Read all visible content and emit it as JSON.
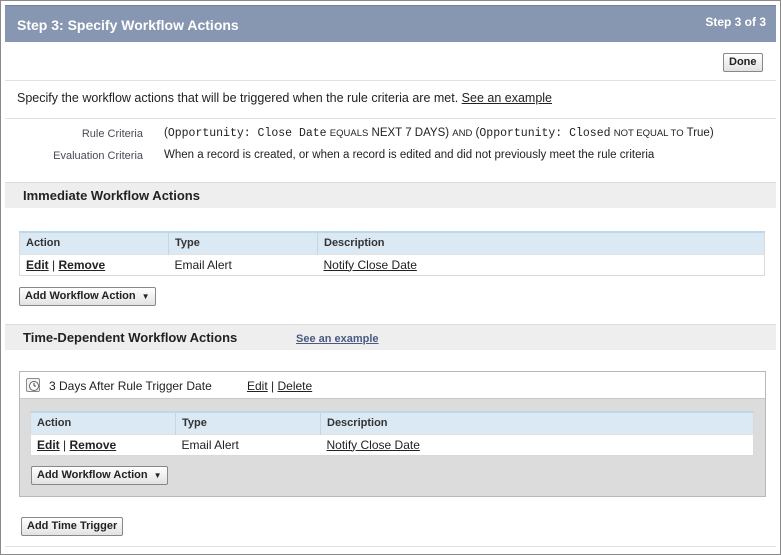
{
  "header": {
    "title": "Step 3: Specify Workflow Actions",
    "step": "Step 3 of 3"
  },
  "toolbar": {
    "done_label": "Done"
  },
  "intro": {
    "text": "Specify the workflow actions that will be triggered when the rule criteria are met.",
    "example_link": "See an example"
  },
  "criteria": {
    "rule_label": "Rule Criteria",
    "rule": {
      "open1": "(",
      "field1": "Opportunity: Close Date",
      "op1": "EQUALS",
      "val1": "NEXT 7 DAYS)",
      "and": "AND",
      "open2": "(",
      "field2": "Opportunity: Closed",
      "op2": "NOT EQUAL TO",
      "val2": "True)"
    },
    "eval_label": "Evaluation Criteria",
    "eval_value": "When a record is created, or when a record is edited and did not previously meet the rule criteria"
  },
  "immediate": {
    "title": "Immediate Workflow Actions",
    "columns": [
      "Action",
      "Type",
      "Description"
    ],
    "rows": [
      {
        "edit": "Edit",
        "sep": "|",
        "remove": "Remove",
        "type": "Email Alert",
        "description": "Notify Close Date"
      }
    ],
    "add_button": "Add Workflow Action"
  },
  "time_dependent": {
    "title": "Time-Dependent Workflow Actions",
    "example_link": "See an example",
    "trigger": {
      "icon": "clock-icon",
      "title": "3 Days After Rule Trigger Date",
      "edit": "Edit",
      "sep": "|",
      "delete": "Delete",
      "columns": [
        "Action",
        "Type",
        "Description"
      ],
      "rows": [
        {
          "edit": "Edit",
          "sep": "|",
          "remove": "Remove",
          "type": "Email Alert",
          "description": "Notify Close Date"
        }
      ],
      "add_button": "Add Workflow Action"
    },
    "add_trigger_button": "Add Time Trigger"
  },
  "colors": {
    "header_bg": "#8797b2",
    "section_bg": "#eeeeee",
    "table_header_bg": "#dbe9f4"
  }
}
